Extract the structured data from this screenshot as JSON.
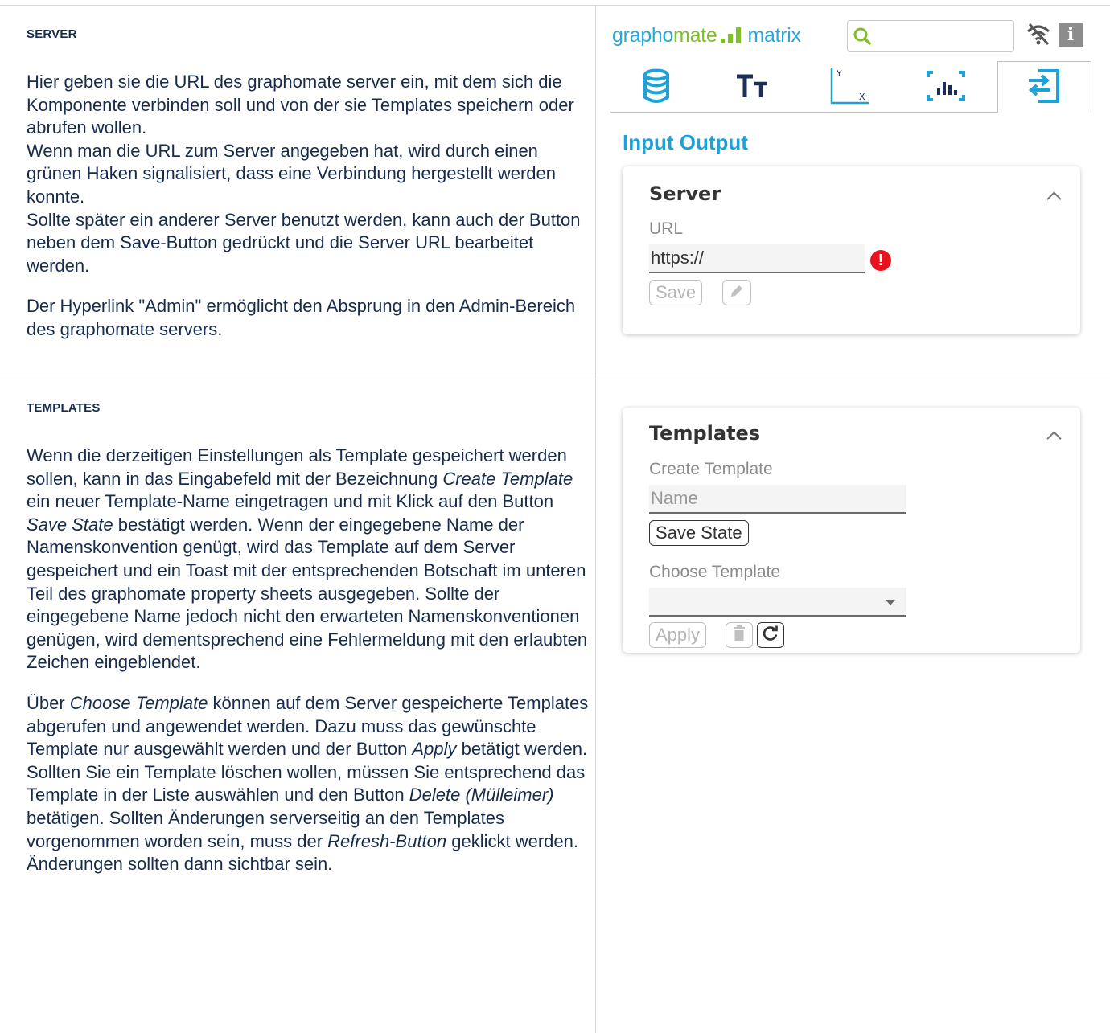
{
  "server_section": {
    "heading": "SERVER",
    "paragraphs": [
      "Hier geben sie die URL des graphomate server ein, mit dem sich die Komponente verbinden soll und von der sie Templates speichern oder abrufen wollen.",
      "Wenn man die URL zum Server angegeben hat, wird durch einen grünen Haken signalisiert, dass eine Verbindung hergestellt werden konnte.",
      "Sollte später ein anderer Server benutzt werden, kann auch der Button neben dem Save-Button gedrückt und die Server URL bearbeitet werden.",
      "Der Hyperlink \"Admin\" ermöglicht den Absprung in den Admin-Bereich des graphomate servers."
    ]
  },
  "templates_section": {
    "heading": "TEMPLATES",
    "p1": {
      "t1": "Wenn die derzeitigen Einstellungen als Template gespeichert werden sollen, kann in das Eingabefeld mit der Bezeichnung ",
      "em1": "Create Template",
      "t2": " ein neuer Template-Name eingetragen und mit Klick auf den Button ",
      "em2": "Save State",
      "t3": " bestätigt werden. Wenn der eingegebene Name der Namenskonvention genügt, wird das Template auf dem Server gespeichert und ein Toast mit der entsprechenden Botschaft im unteren Teil des graphomate property sheets ausgegeben. Sollte der eingegebene Name jedoch nicht den erwarteten Namenskonventionen genügen, wird dementsprechend eine Fehlermeldung mit den erlaubten Zeichen eingeblendet."
    },
    "p2": {
      "t1": "Über ",
      "em1": "Choose Template",
      "t2": " können auf dem Server gespeicherte Templates abgerufen und angewendet werden. Dazu muss das gewünschte Template nur ausgewählt werden und der Button ",
      "em2": "Apply",
      "t3": " betätigt werden. Sollten Sie ein Template löschen wollen, müssen Sie entsprechend das Template in der Liste auswählen und den Button ",
      "em3": "Delete (Mülleimer)",
      "t4": " betätigen. Sollten Änderungen serverseitig an den Templates vorgenommen worden sein, muss der ",
      "em4": "Refresh-Button",
      "t5": " geklickt werden. Änderungen sollten dann sichtbar sein."
    }
  },
  "property_sheet": {
    "logo": {
      "part1": "grapho",
      "part2": "mate",
      "part3": "matrix"
    },
    "search": {
      "value": "",
      "placeholder": ""
    },
    "tabs": [
      {
        "icon": "database-icon"
      },
      {
        "icon": "text-size-icon"
      },
      {
        "icon": "axis-icon"
      },
      {
        "icon": "chart-focus-icon"
      },
      {
        "icon": "input-output-icon",
        "active": true
      }
    ],
    "panel_title": "Input Output",
    "server_card": {
      "title": "Server",
      "url_label": "URL",
      "url_value": "https://",
      "save_label": "Save"
    },
    "templates_card": {
      "title": "Templates",
      "create_label": "Create Template",
      "name_placeholder": "Name",
      "save_state_label": "Save State",
      "choose_label": "Choose Template",
      "choose_value": "",
      "apply_label": "Apply"
    },
    "colors": {
      "brand_blue": "#1ba2d8",
      "brand_green": "#7fbf2a",
      "error_red": "#e8121c"
    }
  }
}
